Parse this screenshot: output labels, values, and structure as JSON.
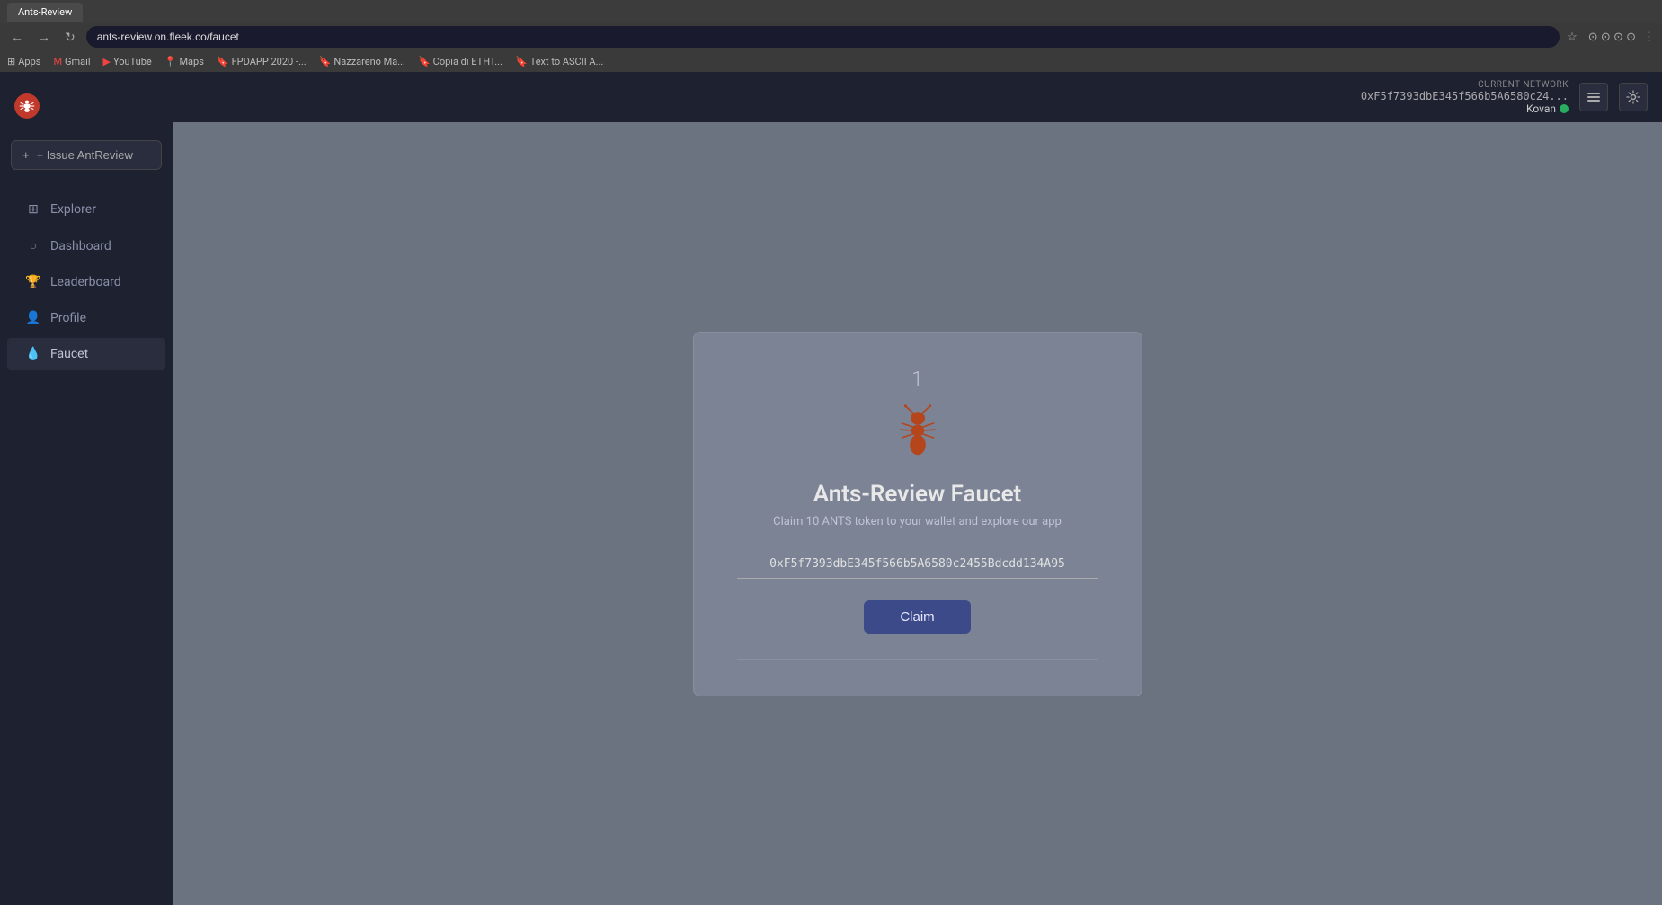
{
  "browser": {
    "url": "ants-review.on.fleek.co/faucet",
    "tabs": [
      {
        "label": "Ants-Review",
        "active": true
      }
    ],
    "bookmarks": [
      {
        "label": "Apps",
        "icon": "grid"
      },
      {
        "label": "Gmail",
        "icon": "gmail"
      },
      {
        "label": "YouTube",
        "icon": "youtube"
      },
      {
        "label": "Maps",
        "icon": "maps"
      },
      {
        "label": "FPDAPP 2020 -...",
        "icon": "bookmark"
      },
      {
        "label": "Nazzareno Ma...",
        "icon": "bookmark"
      },
      {
        "label": "Copia di ETHT...",
        "icon": "bookmark"
      },
      {
        "label": "Text to ASCII A...",
        "icon": "bookmark"
      }
    ]
  },
  "header": {
    "network_label": "CURRENT NETWORK",
    "network_name": "Kovan",
    "wallet_address": "0xF5f7393dbE345f566b5A6580c24...",
    "list_icon_label": "list-icon",
    "settings_icon_label": "settings-icon"
  },
  "sidebar": {
    "logo_icon": "🐜",
    "issue_btn_label": "+ Issue AntReview",
    "nav_items": [
      {
        "id": "explorer",
        "label": "Explorer",
        "icon": "⊞"
      },
      {
        "id": "dashboard",
        "label": "Dashboard",
        "icon": "👤"
      },
      {
        "id": "leaderboard",
        "label": "Leaderboard",
        "icon": "🏆"
      },
      {
        "id": "profile",
        "label": "Profile",
        "icon": "👤"
      },
      {
        "id": "faucet",
        "label": "Faucet",
        "icon": "💧",
        "active": true
      }
    ]
  },
  "faucet": {
    "step_number": "1",
    "title": "Ants-Review Faucet",
    "subtitle": "Claim 10 ANTS token to your wallet and explore our app",
    "wallet_address": "0xF5f7393dbE345f566b5A6580c2455Bdcdd134A95",
    "claim_button_label": "Claim"
  }
}
